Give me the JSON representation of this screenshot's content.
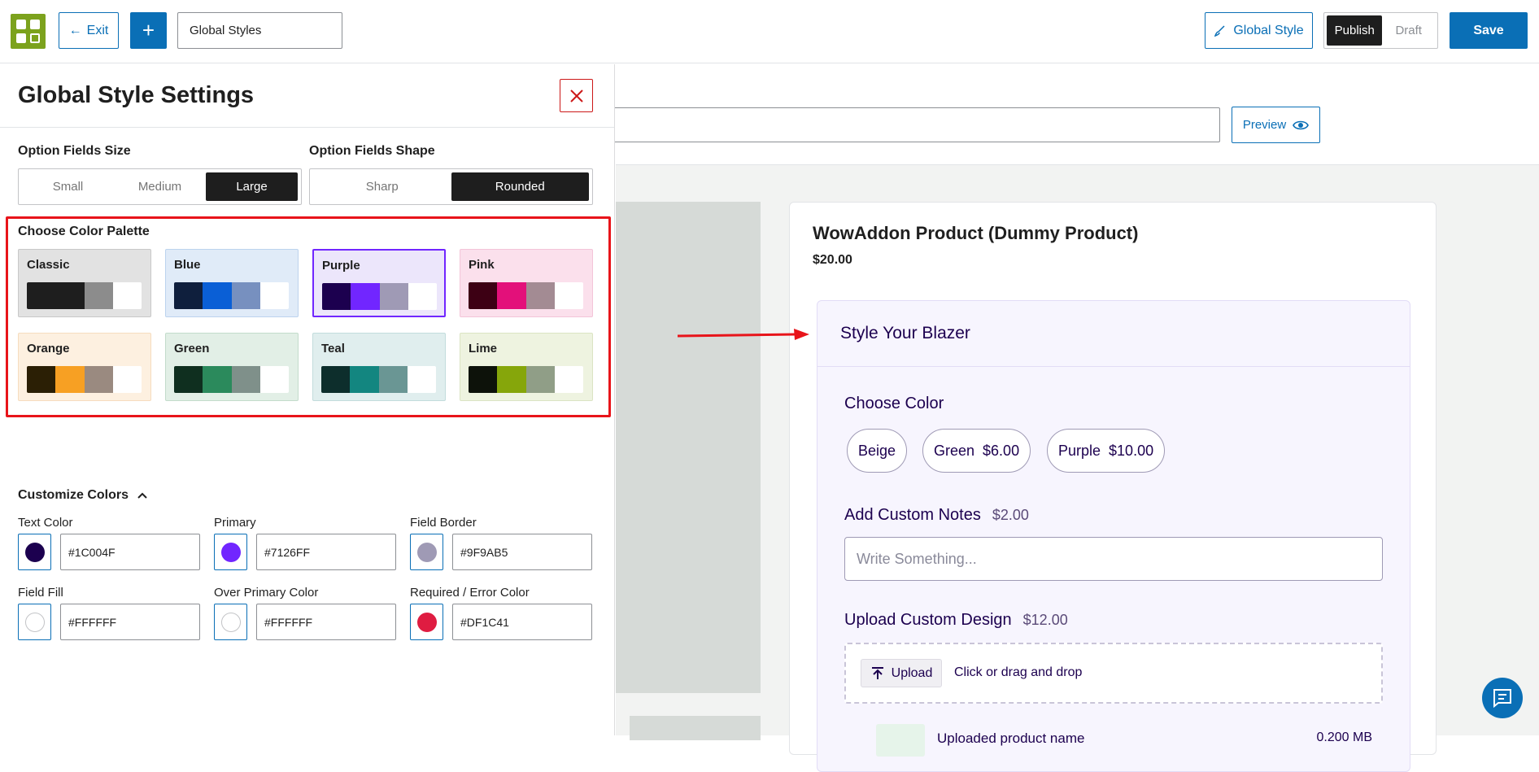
{
  "topbar": {
    "exit_label": "Exit",
    "plus_label": "+",
    "title_value": "Global Styles",
    "global_style_label": "Global Style",
    "publish_label": "Publish",
    "draft_label": "Draft",
    "save_label": "Save"
  },
  "panel": {
    "title": "Global Style Settings",
    "size_label": "Option Fields Size",
    "size_options": [
      "Small",
      "Medium",
      "Large"
    ],
    "size_selected": "Large",
    "shape_label": "Option Fields Shape",
    "shape_options": [
      "Sharp",
      "Rounded"
    ],
    "shape_selected": "Rounded",
    "palette_label": "Choose Color Palette",
    "palettes": [
      {
        "name": "Classic",
        "bg": "#e2e2e2",
        "border": "#c8c8c8",
        "colors": [
          "#1e1e1e",
          "#1e1e1e",
          "#8c8c8c",
          "#ffffff"
        ]
      },
      {
        "name": "Blue",
        "bg": "#e0ebf8",
        "border": "#bcd3ee",
        "colors": [
          "#0f1f3d",
          "#0a5fd6",
          "#7790bf",
          "#ffffff"
        ]
      },
      {
        "name": "Purple",
        "bg": "#ece6fb",
        "border": "#7126ff",
        "colors": [
          "#1c004f",
          "#7126ff",
          "#9f9ab5",
          "#ffffff"
        ]
      },
      {
        "name": "Pink",
        "bg": "#fbe0ec",
        "border": "#f3c4d8",
        "colors": [
          "#3d0014",
          "#e3107a",
          "#a38b93",
          "#ffffff"
        ]
      },
      {
        "name": "Orange",
        "bg": "#fdf0e0",
        "border": "#f6dcbe",
        "colors": [
          "#2b1f05",
          "#f7a023",
          "#9a8a80",
          "#ffffff"
        ]
      },
      {
        "name": "Green",
        "bg": "#e2efe6",
        "border": "#c3dccb",
        "colors": [
          "#0f2f1f",
          "#2b8a5c",
          "#7f908a",
          "#ffffff"
        ]
      },
      {
        "name": "Teal",
        "bg": "#e0eeee",
        "border": "#c2dcdc",
        "colors": [
          "#0d2e2c",
          "#138680",
          "#6a9694",
          "#ffffff"
        ]
      },
      {
        "name": "Lime",
        "bg": "#eef3e0",
        "border": "#dbe4c3",
        "colors": [
          "#0d120a",
          "#86a60b",
          "#909e87",
          "#ffffff"
        ]
      }
    ],
    "customize_label": "Customize Colors",
    "fields": [
      {
        "label": "Text Color",
        "hex": "#1C004F",
        "color": "#1c004f"
      },
      {
        "label": "Primary",
        "hex": "#7126FF",
        "color": "#7126ff"
      },
      {
        "label": "Field Border",
        "hex": "#9F9AB5",
        "color": "#9f9ab5"
      },
      {
        "label": "Field Fill",
        "hex": "#FFFFFF",
        "color": "#ffffff"
      },
      {
        "label": "Over Primary Color",
        "hex": "#FFFFFF",
        "color": "#ffffff"
      },
      {
        "label": "Required / Error Color",
        "hex": "#DF1C41",
        "color": "#df1c41"
      }
    ]
  },
  "canvas": {
    "preview_label": "Preview",
    "product_title": "WowAddon Product (Dummy Product)",
    "product_price": "$20.00",
    "section_title": "Style Your Blazer",
    "choose_color_label": "Choose Color",
    "color_options": [
      {
        "name": "Beige",
        "price": ""
      },
      {
        "name": "Green",
        "price": "$6.00"
      },
      {
        "name": "Purple",
        "price": "$10.00"
      }
    ],
    "notes_label": "Add Custom Notes",
    "notes_price": "$2.00",
    "notes_placeholder": "Write Something...",
    "upload_label": "Upload Custom Design",
    "upload_price": "$12.00",
    "upload_button": "Upload",
    "upload_hint": "Click or drag and drop",
    "file_name": "Uploaded product name",
    "file_size": "0.200 MB"
  }
}
